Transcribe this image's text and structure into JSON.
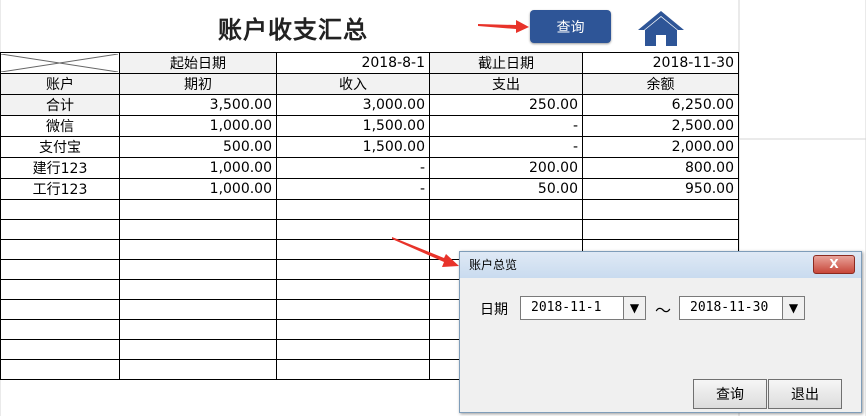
{
  "sheet": {
    "title": "账户收支汇总",
    "query_button": "查询",
    "home_icon": "home-icon"
  },
  "table": {
    "row1": {
      "start_label": "起始日期",
      "start_value": "2018-8-1",
      "end_label": "截止日期",
      "end_value": "2018-11-30"
    },
    "headers": [
      "账户",
      "期初",
      "收入",
      "支出",
      "余额"
    ],
    "total": {
      "label": "合计",
      "opening": "3,500.00",
      "income": "3,000.00",
      "expense": "250.00",
      "balance": "6,250.00"
    },
    "rows": [
      {
        "account": "微信",
        "opening": "1,000.00",
        "income": "1,500.00",
        "expense": "-",
        "balance": "2,500.00"
      },
      {
        "account": "支付宝",
        "opening": "500.00",
        "income": "1,500.00",
        "expense": "-",
        "balance": "2,000.00"
      },
      {
        "account": "建行123",
        "opening": "1,000.00",
        "income": "-",
        "expense": "200.00",
        "balance": "800.00"
      },
      {
        "account": "工行123",
        "opening": "1,000.00",
        "income": "-",
        "expense": "50.00",
        "balance": "950.00"
      }
    ]
  },
  "dialog": {
    "title": "账户总览",
    "close": "X",
    "date_label": "日期",
    "from_date": "2018-11-1",
    "to_date": "2018-11-30",
    "separator": "～",
    "query_button": "查询",
    "exit_button": "退出"
  },
  "colors": {
    "button_blue": "#2e5597",
    "arrow_red": "#e8332a",
    "home_blue": "#2e5597"
  }
}
